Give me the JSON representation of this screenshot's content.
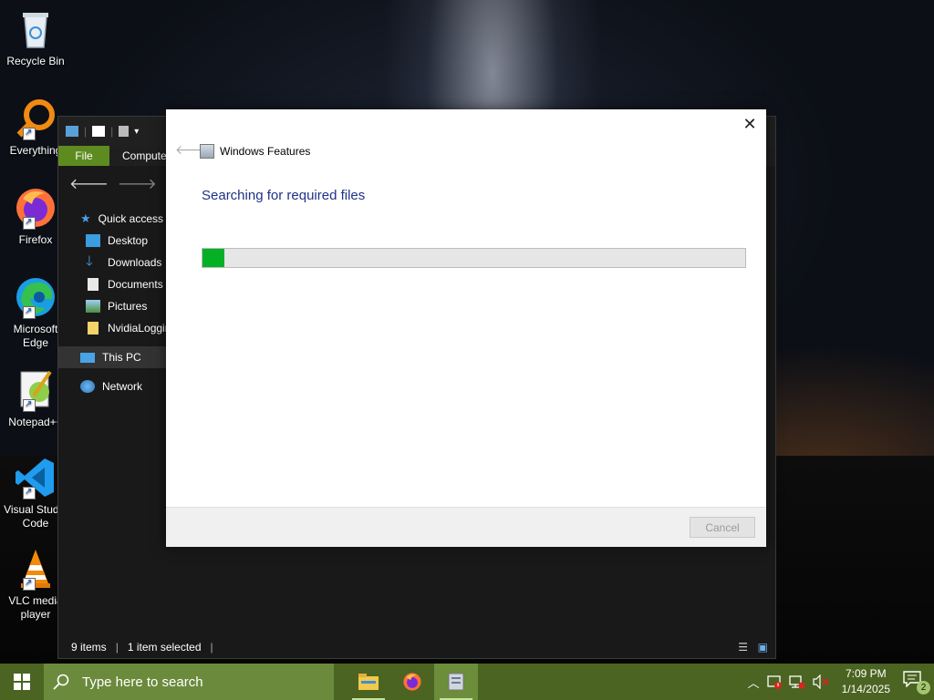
{
  "desktop": {
    "icons": [
      {
        "label": "Recycle Bin"
      },
      {
        "label": "Everything"
      },
      {
        "label": "Firefox"
      },
      {
        "label": "Microsoft Edge"
      },
      {
        "label": "Notepad++"
      },
      {
        "label": "Visual Studio Code"
      },
      {
        "label": "VLC media player"
      }
    ]
  },
  "explorer": {
    "ribbon": {
      "file": "File",
      "computer": "Computer"
    },
    "nav": {
      "quick_access": "Quick access",
      "desktop": "Desktop",
      "downloads": "Downloads",
      "documents": "Documents",
      "pictures": "Pictures",
      "nvidia": "NvidiaLogging",
      "this_pc": "This PC",
      "network": "Network"
    },
    "status": {
      "items": "9 items",
      "selected": "1 item selected"
    }
  },
  "dialog": {
    "title": "Windows Features",
    "heading": "Searching for required files",
    "progress": 0.04,
    "cancel": "Cancel"
  },
  "taskbar": {
    "search_placeholder": "Type here to search",
    "time": "7:09 PM",
    "date": "1/14/2025",
    "notification_count": "2"
  },
  "colors": {
    "progress_green": "#06b025",
    "heading_blue": "#1e3287",
    "taskbar": "#4b6422",
    "file_tab": "#5d8b1f"
  }
}
